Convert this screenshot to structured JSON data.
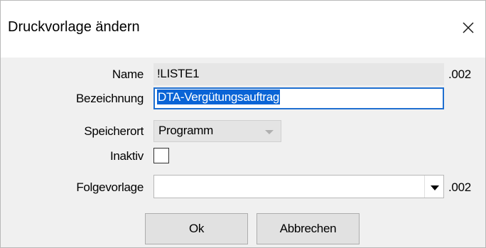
{
  "dialog": {
    "title": "Druckvorlage ändern",
    "close_icon": "close-icon"
  },
  "form": {
    "name": {
      "label": "Name",
      "value": "!LISTE1",
      "suffix": ".002"
    },
    "bezeichnung": {
      "label": "Bezeichnung",
      "value": "DTA-Vergütungsauftrag"
    },
    "speicherort": {
      "label": "Speicherort",
      "value": "Programm"
    },
    "inaktiv": {
      "label": "Inaktiv",
      "checked": false
    },
    "folgevorlage": {
      "label": "Folgevorlage",
      "value": "",
      "suffix": ".002"
    }
  },
  "buttons": {
    "ok": "Ok",
    "cancel": "Abbrechen"
  },
  "colors": {
    "selection": "#0a64d6",
    "focus_border": "#1f6fd0",
    "dialog_bg": "#f0f0f0"
  }
}
